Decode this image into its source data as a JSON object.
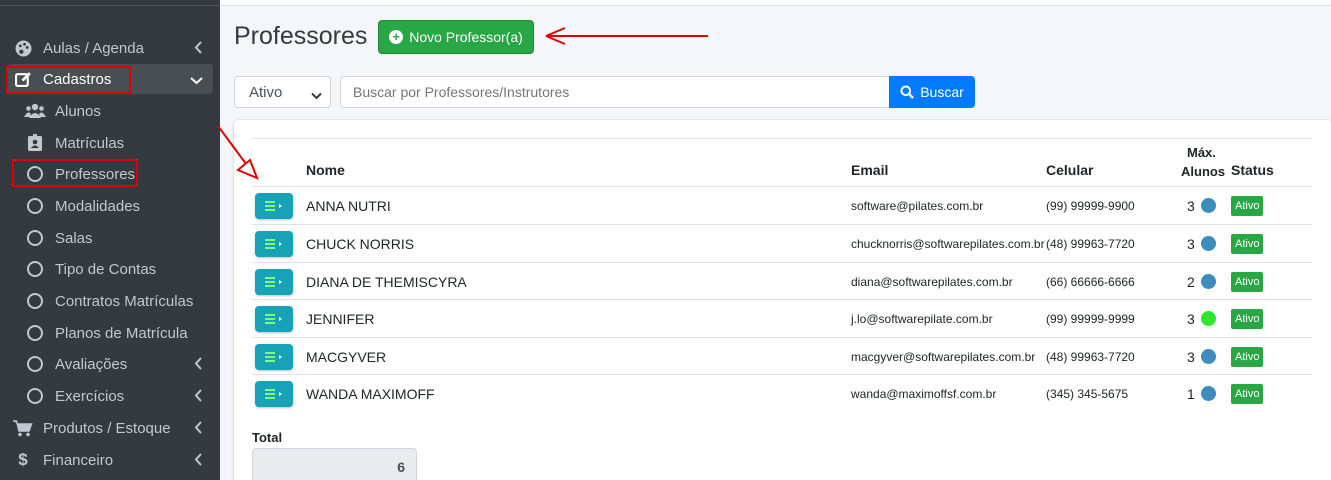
{
  "sidebar": {
    "items": [
      {
        "label": "Aulas / Agenda",
        "icon": "palette-icon"
      },
      {
        "label": "Cadastros",
        "icon": "edit-icon"
      },
      {
        "label": "Alunos",
        "icon": "users-icon"
      },
      {
        "label": "Matrículas",
        "icon": "id-badge-icon"
      },
      {
        "label": "Professores",
        "icon": "circle-icon"
      },
      {
        "label": "Modalidades",
        "icon": "circle-icon"
      },
      {
        "label": "Salas",
        "icon": "circle-icon"
      },
      {
        "label": "Tipo de Contas",
        "icon": "circle-icon"
      },
      {
        "label": "Contratos Matrículas",
        "icon": "circle-icon"
      },
      {
        "label": "Planos de Matrícula",
        "icon": "circle-icon"
      },
      {
        "label": "Avaliações",
        "icon": "circle-icon"
      },
      {
        "label": "Exercícios",
        "icon": "circle-icon"
      },
      {
        "label": "Produtos / Estoque",
        "icon": "cart-icon"
      },
      {
        "label": "Financeiro",
        "icon": "dollar-icon"
      }
    ]
  },
  "header": {
    "title": "Professores",
    "new_button": "Novo Professor(a)"
  },
  "filters": {
    "status_selected": "Ativo",
    "search_placeholder": "Buscar por Professores/Instrutores",
    "search_button": "Buscar"
  },
  "table": {
    "headers": {
      "nome": "Nome",
      "email": "Email",
      "celular": "Celular",
      "max_line1": "Máx.",
      "max_line2": "Alunos",
      "status": "Status"
    },
    "rows": [
      {
        "nome": "ANNA NUTRI",
        "email": "software@pilates.com.br",
        "celular": "(99) 99999-9900",
        "max": "3",
        "status": "Ativo"
      },
      {
        "nome": "CHUCK NORRIS",
        "email": "chucknorris@softwarepilates.com.br",
        "celular": "(48) 99963-7720",
        "max": "3",
        "status": "Ativo"
      },
      {
        "nome": "DIANA DE THEMISCYRA",
        "email": "diana@softwarepilates.com.br",
        "celular": "(66) 66666-6666",
        "max": "2",
        "status": "Ativo"
      },
      {
        "nome": "JENNIFER",
        "email": "j.lo@softwarepilate.com.br",
        "celular": "(99) 99999-9999",
        "max": "3",
        "status": "Ativo"
      },
      {
        "nome": "MACGYVER",
        "email": "macgyver@softwarepilates.com.br",
        "celular": "(48) 99963-7720",
        "max": "3",
        "status": "Ativo"
      },
      {
        "nome": "WANDA MAXIMOFF",
        "email": "wanda@maximoffsf.com.br",
        "celular": "(345) 345-5675",
        "max": "1",
        "status": "Ativo"
      }
    ]
  },
  "total": {
    "label": "Total",
    "value": "6"
  },
  "colors": {
    "sidebar_bg": "#343a40",
    "success": "#28a745",
    "primary": "#007bff",
    "info": "#17a2b8",
    "dot_default": "#3c8dbc",
    "dot_online": "#2ee62e",
    "annotation_red": "#e00000"
  },
  "row_dot_colors": [
    "#3c8dbc",
    "#3c8dbc",
    "#3c8dbc",
    "#2ee62e",
    "#3c8dbc",
    "#3c8dbc"
  ]
}
